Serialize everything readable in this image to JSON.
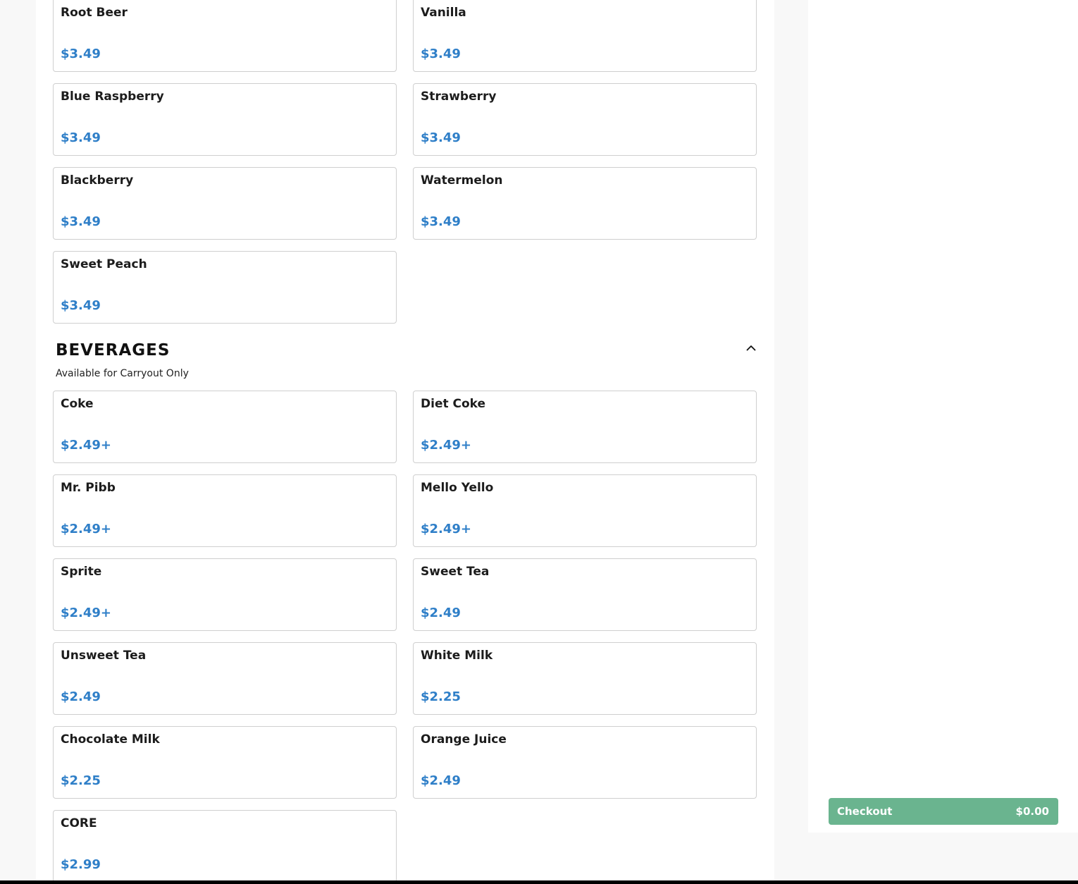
{
  "menu": {
    "previous_section_items": [
      {
        "name": "Root Beer",
        "price": "$3.49"
      },
      {
        "name": "Vanilla",
        "price": "$3.49"
      },
      {
        "name": "Blue Raspberry",
        "price": "$3.49"
      },
      {
        "name": "Strawberry",
        "price": "$3.49"
      },
      {
        "name": "Blackberry",
        "price": "$3.49"
      },
      {
        "name": "Watermelon",
        "price": "$3.49"
      },
      {
        "name": "Sweet Peach",
        "price": "$3.49"
      }
    ],
    "beverages": {
      "title": "BEVERAGES",
      "subtitle": "Available for Carryout Only",
      "toggle_icon": "chevron-up-icon",
      "items": [
        {
          "name": "Coke",
          "price": "$2.49+"
        },
        {
          "name": "Diet Coke",
          "price": "$2.49+"
        },
        {
          "name": "Mr. Pibb",
          "price": "$2.49+"
        },
        {
          "name": "Mello Yello",
          "price": "$2.49+"
        },
        {
          "name": "Sprite",
          "price": "$2.49+"
        },
        {
          "name": "Sweet Tea",
          "price": "$2.49"
        },
        {
          "name": "Unsweet Tea",
          "price": "$2.49"
        },
        {
          "name": "White Milk",
          "price": "$2.25"
        },
        {
          "name": "Chocolate Milk",
          "price": "$2.25"
        },
        {
          "name": "Orange Juice",
          "price": "$2.49"
        },
        {
          "name": "CORE",
          "price": "$2.99"
        }
      ]
    }
  },
  "cart": {
    "checkout_label": "Checkout",
    "total": "$0.00"
  },
  "colors": {
    "price": "#2f7fc8",
    "checkout_button": "#6ab48f",
    "card_border": "#cfcfcf",
    "page_background": "#f8f8f8"
  }
}
